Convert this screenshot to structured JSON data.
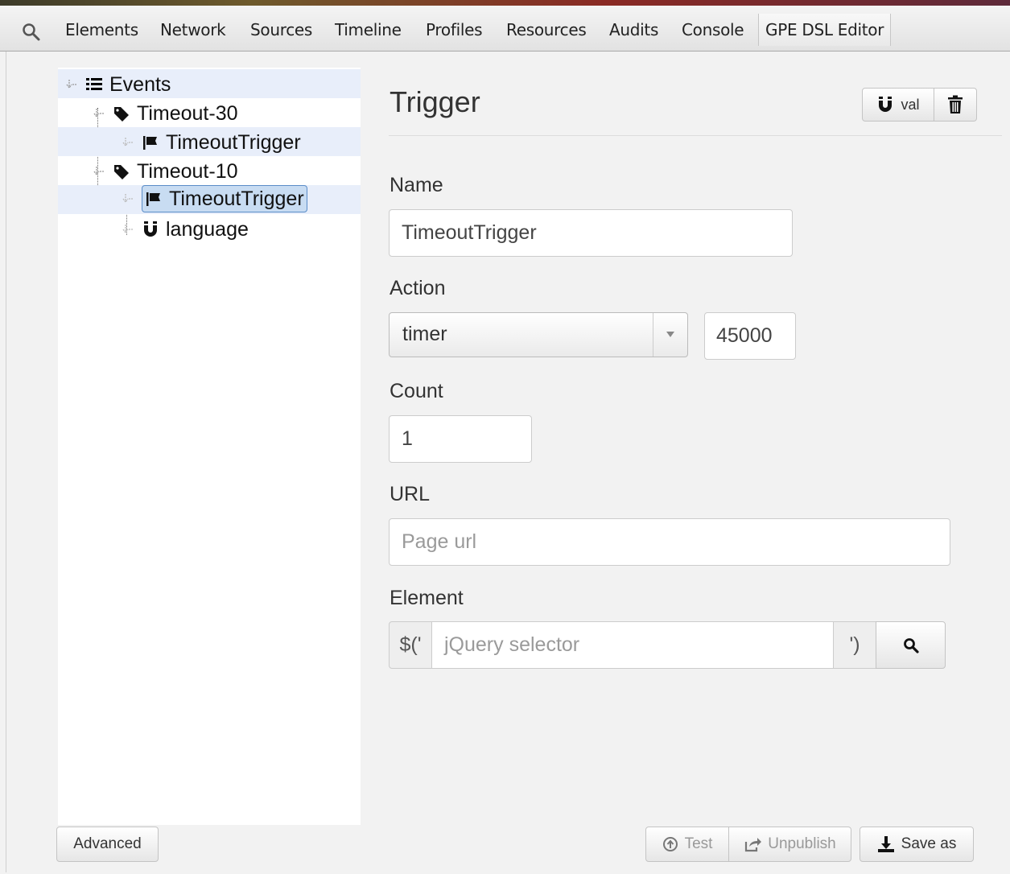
{
  "devtools": {
    "tabs": [
      "Elements",
      "Network",
      "Sources",
      "Timeline",
      "Profiles",
      "Resources",
      "Audits",
      "Console",
      "GPE DSL Editor"
    ],
    "active_tab": "GPE DSL Editor"
  },
  "tree": {
    "root": "Events",
    "groups": [
      {
        "label": "Timeout-30",
        "children": [
          "TimeoutTrigger"
        ]
      },
      {
        "label": "Timeout-10",
        "children": [
          "TimeoutTrigger",
          "language"
        ]
      }
    ],
    "selected": "TimeoutTrigger"
  },
  "editor": {
    "title": "Trigger",
    "val_button": "val",
    "name_label": "Name",
    "name_value": "TimeoutTrigger",
    "action_label": "Action",
    "action_value": "timer",
    "action_param": "45000",
    "count_label": "Count",
    "count_value": "1",
    "url_label": "URL",
    "url_placeholder": "Page url",
    "element_label": "Element",
    "element_prefix": "$('",
    "element_placeholder": "jQuery selector",
    "element_suffix": "')"
  },
  "footer": {
    "advanced": "Advanced",
    "test": "Test",
    "unpublish": "Unpublish",
    "save_as": "Save as"
  }
}
